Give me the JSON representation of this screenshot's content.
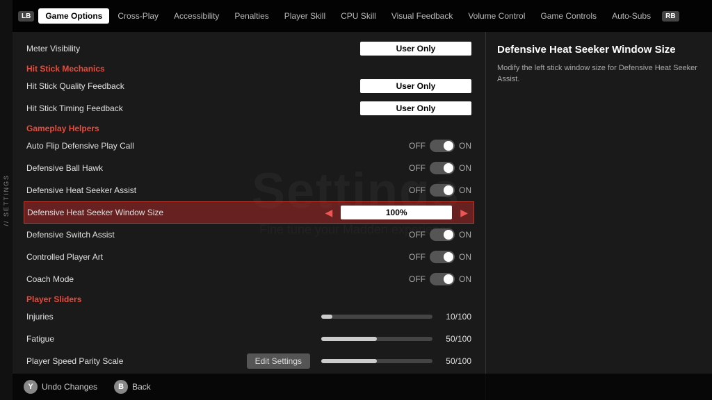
{
  "sidebar": {
    "label": "// SETTINGS"
  },
  "topnav": {
    "lb": "LB",
    "rb": "RB",
    "items": [
      {
        "id": "game-options",
        "label": "Game Options",
        "active": true
      },
      {
        "id": "cross-play",
        "label": "Cross-Play",
        "active": false
      },
      {
        "id": "accessibility",
        "label": "Accessibility",
        "active": false
      },
      {
        "id": "penalties",
        "label": "Penalties",
        "active": false
      },
      {
        "id": "player-skill",
        "label": "Player Skill",
        "active": false
      },
      {
        "id": "cpu-skill",
        "label": "CPU Skill",
        "active": false
      },
      {
        "id": "visual-feedback",
        "label": "Visual Feedback",
        "active": false
      },
      {
        "id": "volume-control",
        "label": "Volume Control",
        "active": false
      },
      {
        "id": "game-controls",
        "label": "Game Controls",
        "active": false
      },
      {
        "id": "auto-subs",
        "label": "Auto-Subs",
        "active": false
      }
    ]
  },
  "watermark": {
    "big": "Settings",
    "small": "Fine tune your Madden experience"
  },
  "settings": {
    "meter_visibility": {
      "label": "Meter Visibility",
      "value": "User Only"
    },
    "hit_stick_section": "Hit Stick Mechanics",
    "hit_stick_quality": {
      "label": "Hit Stick Quality Feedback",
      "value": "User Only"
    },
    "hit_stick_timing": {
      "label": "Hit Stick Timing Feedback",
      "value": "User Only"
    },
    "gameplay_helpers_section": "Gameplay Helpers",
    "auto_flip": {
      "label": "Auto Flip Defensive Play Call",
      "off": "OFF",
      "on": "ON"
    },
    "defensive_ball_hawk": {
      "label": "Defensive Ball Hawk",
      "off": "OFF",
      "on": "ON"
    },
    "defensive_heat_seeker_assist": {
      "label": "Defensive Heat Seeker Assist",
      "off": "OFF",
      "on": "ON"
    },
    "defensive_heat_seeker_window": {
      "label": "Defensive Heat Seeker Window Size",
      "value": "100%"
    },
    "defensive_switch_assist": {
      "label": "Defensive Switch Assist",
      "off": "OFF",
      "on": "ON"
    },
    "controlled_player_art": {
      "label": "Controlled Player Art",
      "off": "OFF",
      "on": "ON"
    },
    "coach_mode": {
      "label": "Coach Mode",
      "off": "OFF",
      "on": "ON"
    },
    "player_sliders_section": "Player Sliders",
    "injuries": {
      "label": "Injuries",
      "value": "10/100",
      "percent": 10
    },
    "fatigue": {
      "label": "Fatigue",
      "value": "50/100",
      "percent": 50
    },
    "player_speed_parity": {
      "label": "Player Speed Parity Scale",
      "value": "50/100",
      "percent": 50
    }
  },
  "right_panel": {
    "title": "Defensive Heat Seeker Window Size",
    "description": "Modify the left stick window size for Defensive Heat Seeker Assist."
  },
  "bottom_bar": {
    "y_label": "Y",
    "undo_label": "Undo Changes",
    "b_label": "B",
    "back_label": "Back",
    "edit_settings_label": "Edit Settings"
  }
}
